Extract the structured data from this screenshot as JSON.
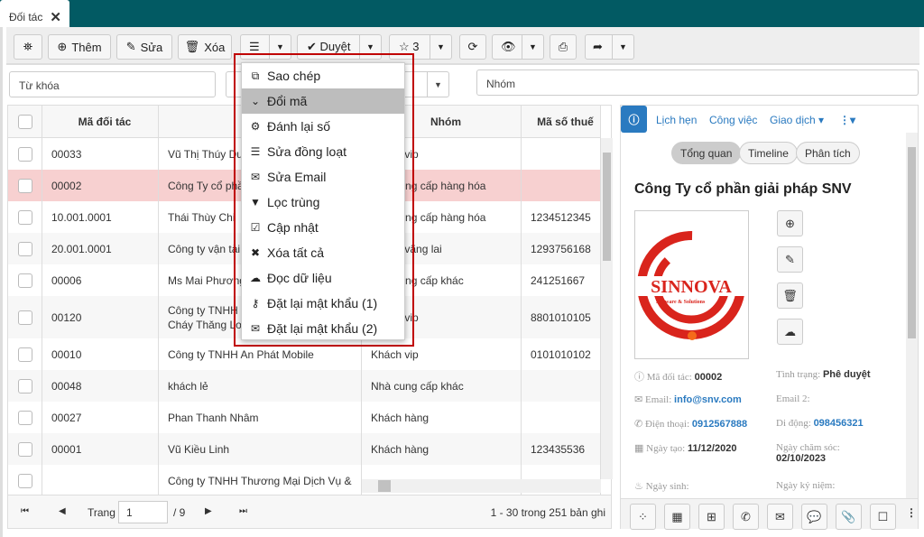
{
  "tab": {
    "title": "Đối tác"
  },
  "toolbar": {
    "add": "Thêm",
    "edit": "Sửa",
    "delete": "Xóa",
    "approve": "Duyệt",
    "star_count": "3"
  },
  "filters": {
    "keyword_placeholder": "Từ khóa",
    "group_placeholder": "Nhóm"
  },
  "grid": {
    "headers": [
      "Mã đối tác",
      "Tên",
      "Nhóm",
      "Mã số thuế"
    ],
    "rows": [
      {
        "code": "00033",
        "name": "Vũ Thị Thúy Duyên",
        "group": "Khách vip",
        "tax": ""
      },
      {
        "code": "00002",
        "name": "Công Ty cổ phần giải pháp SNV",
        "group": "Nhà cung cấp hàng hóa",
        "tax": "",
        "selected": true
      },
      {
        "code": "10.001.0001",
        "name": "Thái Thùy Chi",
        "group": "Nhà cung cấp hàng hóa",
        "tax": "1234512345"
      },
      {
        "code": "20.001.0001",
        "name": "Công ty vận tải Thăng Long",
        "group": "Khách vãng lai",
        "tax": "1293756168"
      },
      {
        "code": "00006",
        "name": "Ms Mai Phương",
        "group": "Nhà cung cấp khác",
        "tax": "241251667"
      },
      {
        "code": "00120",
        "name": "Công ty TNHH Thiết bị Phòng",
        "name2": "Cháy Thăng Long",
        "group": "Khách vip",
        "tax": "8801010105"
      },
      {
        "code": "00010",
        "name": "Công ty TNHH An Phát Mobile",
        "group": "Khách vip",
        "tax": "0101010102"
      },
      {
        "code": "00048",
        "name": "khách lẻ",
        "group": "Nhà cung cấp khác",
        "tax": ""
      },
      {
        "code": "00027",
        "name": "Phan Thanh Nhâm",
        "group": "Khách hàng",
        "tax": ""
      },
      {
        "code": "00001",
        "name": "Vũ Kiều Linh",
        "group": "Khách hàng",
        "tax": "123435536"
      },
      {
        "code": "",
        "name": "Công ty TNHH Thương Mại Dịch Vụ &",
        "group": "",
        "tax": ""
      }
    ]
  },
  "pager": {
    "page_label": "Trang",
    "page": "1",
    "total_pages": "/ 9",
    "summary": "1 - 30 trong 251 bản ghi"
  },
  "menu": {
    "items": [
      {
        "label": "Sao chép",
        "icon": "copy-icon"
      },
      {
        "label": "Đổi mã",
        "icon": "chevron-down-icon",
        "active": true
      },
      {
        "label": "Đánh lại số",
        "icon": "cogs-icon"
      },
      {
        "label": "Sửa đồng loạt",
        "icon": "list-icon"
      },
      {
        "label": "Sửa Email",
        "icon": "envelope-icon"
      },
      {
        "label": "Lọc trùng",
        "icon": "filter-icon"
      },
      {
        "label": "Cập nhật",
        "icon": "check-square-icon"
      },
      {
        "label": "Xóa tất cả",
        "icon": "times-circle-icon"
      },
      {
        "label": "Đọc dữ liệu",
        "icon": "cloud-upload-icon"
      },
      {
        "label": "Đặt lại mật khẩu (1)",
        "icon": "key-icon"
      },
      {
        "label": "Đặt lại mật khẩu (2)",
        "icon": "envelope-icon"
      }
    ]
  },
  "panel": {
    "tabs": [
      "Lịch hẹn",
      "Công việc",
      "Giao dịch"
    ],
    "pills": [
      "Tổng quan",
      "Timeline",
      "Phân tích"
    ],
    "title": "Công Ty cổ phần giải pháp SNV",
    "logo_text": "SINNOVA",
    "logo_sub": "Software & Solutions",
    "fields": {
      "code_label": "Mã đối tác:",
      "code": "00002",
      "status_label": "Tình trạng:",
      "status": "Phê duyệt",
      "email_label": "Email:",
      "email": "info@snv.com",
      "email2_label": "Email 2:",
      "phone_label": "Điện thoại:",
      "phone": "0912567888",
      "mobile_label": "Di động:",
      "mobile": "098456321",
      "created_label": "Ngày tạo:",
      "created": "11/12/2020",
      "care_label": "Ngày chăm sóc:",
      "care": "02/10/2023",
      "birthday_label": "Ngày sinh:",
      "anniv_label": "Ngày kỷ niệm:"
    }
  },
  "colors": {
    "header_bg": "#025a63",
    "accent": "#2a7ac0",
    "selected_row": "#f7d0d0",
    "menu_highlight": "#bdbdbd",
    "highlight_frame": "#c00000"
  }
}
